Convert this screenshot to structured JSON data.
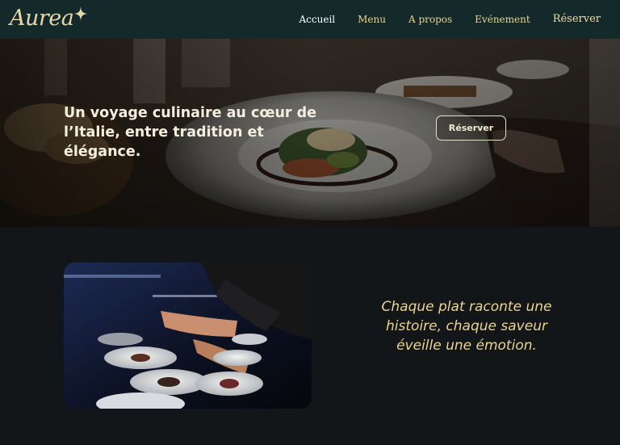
{
  "brand": {
    "name": "Aurea",
    "icon": "sparkle-icon",
    "color": "#e8d7a8"
  },
  "nav": {
    "items": [
      {
        "label": "Accueil",
        "active": true
      },
      {
        "label": "Menu"
      },
      {
        "label": "A propos"
      },
      {
        "label": "Evénement"
      },
      {
        "label": "Réserver"
      }
    ]
  },
  "hero": {
    "title": "Un voyage culinaire au cœur de l’Italie, entre tradition et élégance.",
    "button_label": "Réserver"
  },
  "story": {
    "quote": "Chaque plat raconte une histoire, chaque saveur éveille une émotion."
  },
  "colors": {
    "navbar_bg": "#13292a",
    "nav_text": "#e8d28f",
    "page_bg": "#121618",
    "accent_gold": "#ecd391"
  }
}
